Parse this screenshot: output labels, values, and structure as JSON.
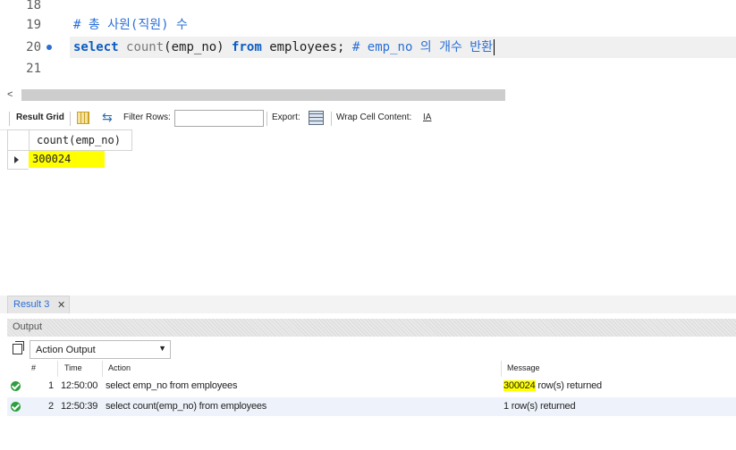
{
  "editor": {
    "lines": [
      {
        "number": "18",
        "text": ""
      },
      {
        "number": "19",
        "comment": "# 총 사원(직원) 수"
      },
      {
        "number": "20",
        "kw_select": "select",
        "fn_name": "count",
        "fn_args": "(emp_no)",
        "kw_from": "from",
        "table": "employees;",
        "comment": "# emp_no 의 개수 반환"
      },
      {
        "number": "21",
        "text": ""
      }
    ]
  },
  "result_toolbar": {
    "result_grid_label": "Result Grid",
    "filter_rows_label": "Filter Rows:",
    "filter_value": "",
    "export_label": "Export:",
    "wrap_cell_label": "Wrap Cell Content:",
    "wrap_icon": "wrap-text-icon"
  },
  "result_grid": {
    "columns": [
      "count(emp_no)"
    ],
    "rows": [
      [
        "300024"
      ]
    ]
  },
  "result_tabs": {
    "active_tab": "Result 3",
    "close_glyph": "✕"
  },
  "output": {
    "title": "Output",
    "selector": "Action Output",
    "columns": {
      "num": "#",
      "time": "Time",
      "action": "Action",
      "message": "Message"
    },
    "rows": [
      {
        "num": "1",
        "time": "12:50:00",
        "action": "select emp_no from employees",
        "message_count": "300024",
        "message_rest": " row(s) returned"
      },
      {
        "num": "2",
        "time": "12:50:39",
        "action": "select count(emp_no) from employees",
        "message_count": "1",
        "message_rest": " row(s) returned"
      }
    ]
  },
  "colors": {
    "keyword": "#0a5cc2",
    "comment": "#2a6fd6",
    "highlight": "#ffff00",
    "success": "#2e9e3e"
  }
}
